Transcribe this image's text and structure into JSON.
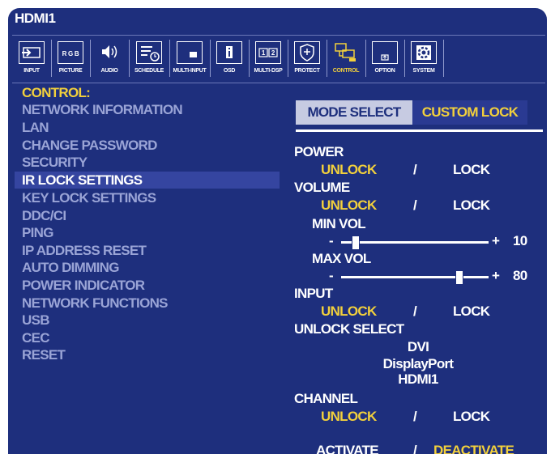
{
  "window": {
    "title": "HDMI1"
  },
  "tabs": [
    {
      "label": "INPUT",
      "icon": "input-icon",
      "selected": false
    },
    {
      "label": "PICTURE",
      "icon": "picture-icon",
      "selected": false
    },
    {
      "label": "AUDIO",
      "icon": "audio-icon",
      "selected": false
    },
    {
      "label": "SCHEDULE",
      "icon": "schedule-icon",
      "selected": false
    },
    {
      "label": "MULTI-INPUT",
      "icon": "multi-input-icon",
      "selected": false
    },
    {
      "label": "OSD",
      "icon": "osd-icon",
      "selected": false
    },
    {
      "label": "MULTI-DSP",
      "icon": "multi-dsp-icon",
      "selected": false
    },
    {
      "label": "PROTECT",
      "icon": "shield-icon",
      "selected": false
    },
    {
      "label": "CONTROL",
      "icon": "control-icon",
      "selected": true
    },
    {
      "label": "OPTION",
      "icon": "option-icon",
      "selected": false
    },
    {
      "label": "SYSTEM",
      "icon": "system-icon",
      "selected": false
    }
  ],
  "menu": {
    "header": "CONTROL:",
    "items": [
      "NETWORK INFORMATION",
      "LAN",
      "CHANGE PASSWORD",
      "SECURITY",
      "IR LOCK SETTINGS",
      "KEY LOCK SETTINGS",
      "DDC/CI",
      "PING",
      "IP ADDRESS RESET",
      "AUTO DIMMING",
      "POWER INDICATOR",
      "NETWORK FUNCTIONS",
      "USB",
      "CEC",
      "RESET"
    ],
    "selected_index": 4
  },
  "panel": {
    "mode_select_label": "MODE SELECT",
    "mode_select_value": "CUSTOM LOCK",
    "power": {
      "label": "POWER",
      "unlock": "UNLOCK",
      "slash": "/",
      "lock": "LOCK"
    },
    "volume": {
      "label": "VOLUME",
      "unlock": "UNLOCK",
      "slash": "/",
      "lock": "LOCK"
    },
    "min_vol": {
      "label": "MIN VOL",
      "minus": "-",
      "plus": "+",
      "value": "10",
      "level": 0.1
    },
    "max_vol": {
      "label": "MAX VOL",
      "minus": "-",
      "plus": "+",
      "value": "80",
      "level": 0.8
    },
    "input": {
      "label": "INPUT",
      "unlock": "UNLOCK",
      "slash": "/",
      "lock": "LOCK"
    },
    "unlock_select": {
      "label": "UNLOCK SELECT",
      "options": [
        "DVI",
        "DisplayPort",
        "HDMI1"
      ]
    },
    "channel": {
      "label": "CHANNEL",
      "unlock": "UNLOCK",
      "slash": "/",
      "lock": "LOCK"
    },
    "activate": "ACTIVATE",
    "activate_slash": "/",
    "deactivate": "DEACTIVATE"
  },
  "colors": {
    "background": "#1e2f7d",
    "highlight": "#f2d03c",
    "inactive": "#9aa4d6"
  }
}
